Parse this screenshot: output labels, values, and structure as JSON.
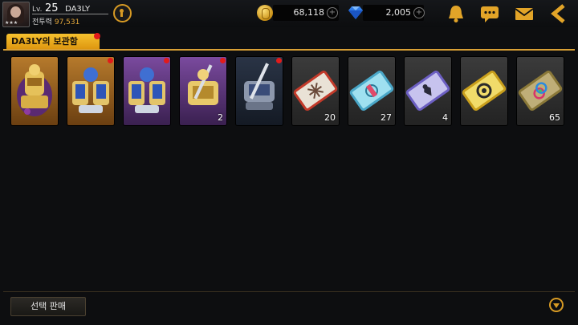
{
  "player": {
    "level_prefix": "Lv.",
    "level": "25",
    "name": "DA3LY",
    "power_label": "전투력",
    "power_value": "97,531",
    "stars": "★★★"
  },
  "currency": {
    "gold": "68,118",
    "gems": "2,005",
    "plus_symbol": "+"
  },
  "header_icons": [
    "map-pin-icon",
    "bell-icon",
    "chat-icon",
    "mail-icon",
    "back-arrow-icon"
  ],
  "tab": {
    "label": "DA3LY의 보관함"
  },
  "items": [
    {
      "kind": "armor-set-gold-purple",
      "frame": "bronze",
      "qty": "",
      "new": false
    },
    {
      "kind": "armor-set-blue-gold",
      "frame": "bronze",
      "qty": "",
      "new": true
    },
    {
      "kind": "armor-set-blue-gold",
      "frame": "purple",
      "qty": "",
      "new": true
    },
    {
      "kind": "armor-set-gold-sword",
      "frame": "purple",
      "qty": "2",
      "new": true
    },
    {
      "kind": "armor-set-steel",
      "frame": "dark",
      "qty": "",
      "new": true
    },
    {
      "kind": "ticket-red",
      "frame": "grey",
      "qty": "20",
      "new": false
    },
    {
      "kind": "ticket-cyan",
      "frame": "grey",
      "qty": "27",
      "new": false
    },
    {
      "kind": "ticket-purple",
      "frame": "grey",
      "qty": "4",
      "new": false
    },
    {
      "kind": "ticket-yellow",
      "frame": "grey",
      "qty": "",
      "new": false
    },
    {
      "kind": "ticket-gold-gender",
      "frame": "grey",
      "qty": "65",
      "new": false
    }
  ],
  "footer": {
    "sell_label": "선택 판매"
  },
  "colors": {
    "accent": "#de9710",
    "alert_dot": "#e21b1b",
    "power_value": "#e0a53a"
  }
}
